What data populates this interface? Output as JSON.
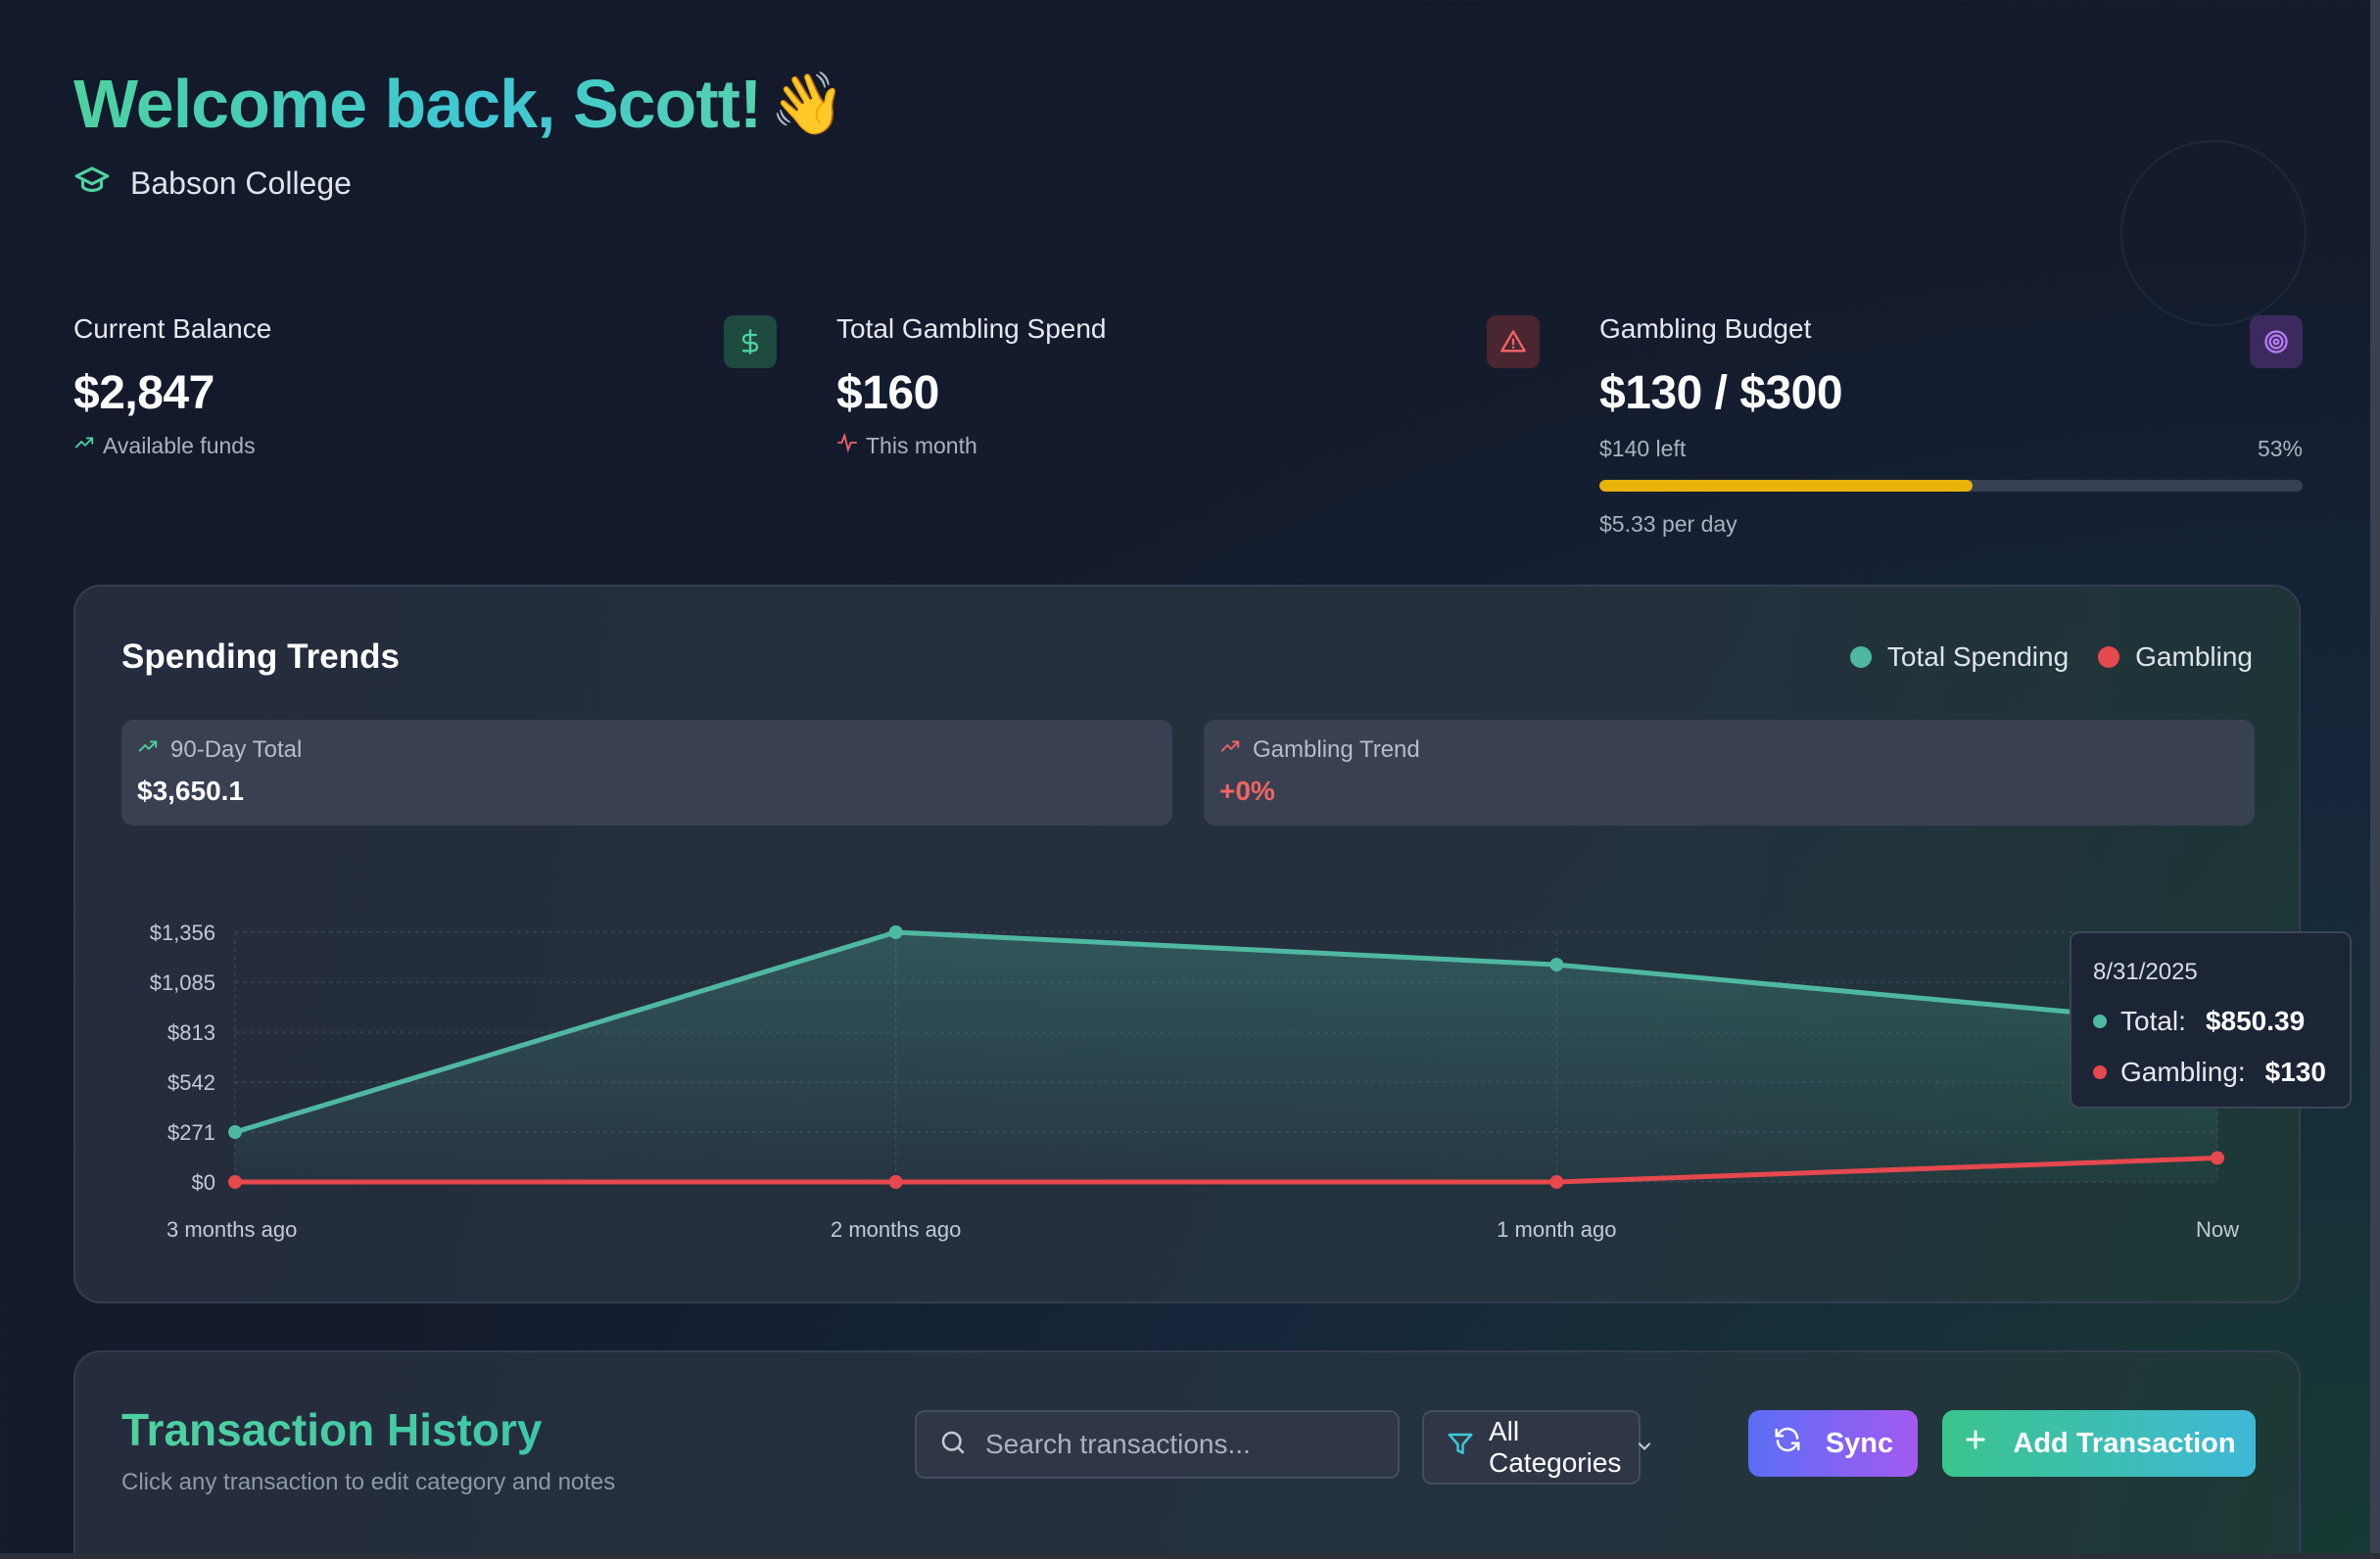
{
  "header": {
    "welcome": "Welcome back, Scott!",
    "wave_emoji": "👋",
    "school": "Babson College",
    "school_icon": "graduation-cap-icon"
  },
  "stats": {
    "balance": {
      "label": "Current Balance",
      "value": "$2,847",
      "sub": "Available funds",
      "icon": "dollar-icon",
      "sub_icon": "trending-up-icon"
    },
    "gambling": {
      "label": "Total Gambling Spend",
      "value": "$160",
      "sub": "This month",
      "icon": "alert-triangle-icon",
      "sub_icon": "activity-icon"
    },
    "budget": {
      "label": "Gambling Budget",
      "value": "$130 / $300",
      "left": "$140 left",
      "percent_label": "53%",
      "progress": 0.53,
      "per_day": "$5.33 per day",
      "icon": "target-icon"
    }
  },
  "colors": {
    "total": "#4fb8a0",
    "gambling": "#e5484d",
    "budget_bar": "#eab308",
    "accent_green": "#4fd1a0"
  },
  "trends": {
    "title": "Spending Trends",
    "legend_total": "Total Spending",
    "legend_gambling": "Gambling",
    "total_label": "90-Day Total",
    "total_value": "$3,650.1",
    "trend_label": "Gambling Trend",
    "trend_value": "+0%"
  },
  "chart_data": {
    "type": "line",
    "categories": [
      "3 months ago",
      "2 months ago",
      "1 month ago",
      "Now"
    ],
    "y_ticks": [
      "$0",
      "$271",
      "$542",
      "$813",
      "$1,085",
      "$1,356"
    ],
    "ylim": [
      0,
      1356
    ],
    "grid": true,
    "series": [
      {
        "name": "Total Spending",
        "values": [
          271,
          1356,
          1180,
          850.39
        ]
      },
      {
        "name": "Gambling",
        "values": [
          0,
          0,
          0,
          130
        ]
      }
    ]
  },
  "tooltip": {
    "date": "8/31/2025",
    "total_label": "Total:",
    "total_value": "$850.39",
    "gambling_label": "Gambling:",
    "gambling_value": "$130"
  },
  "transactions": {
    "title": "Transaction History",
    "subtitle": "Click any transaction to edit category and notes",
    "search_placeholder": "Search transactions...",
    "category_select": "All Categories",
    "sync_label": "Sync",
    "add_label": "Add Transaction"
  }
}
